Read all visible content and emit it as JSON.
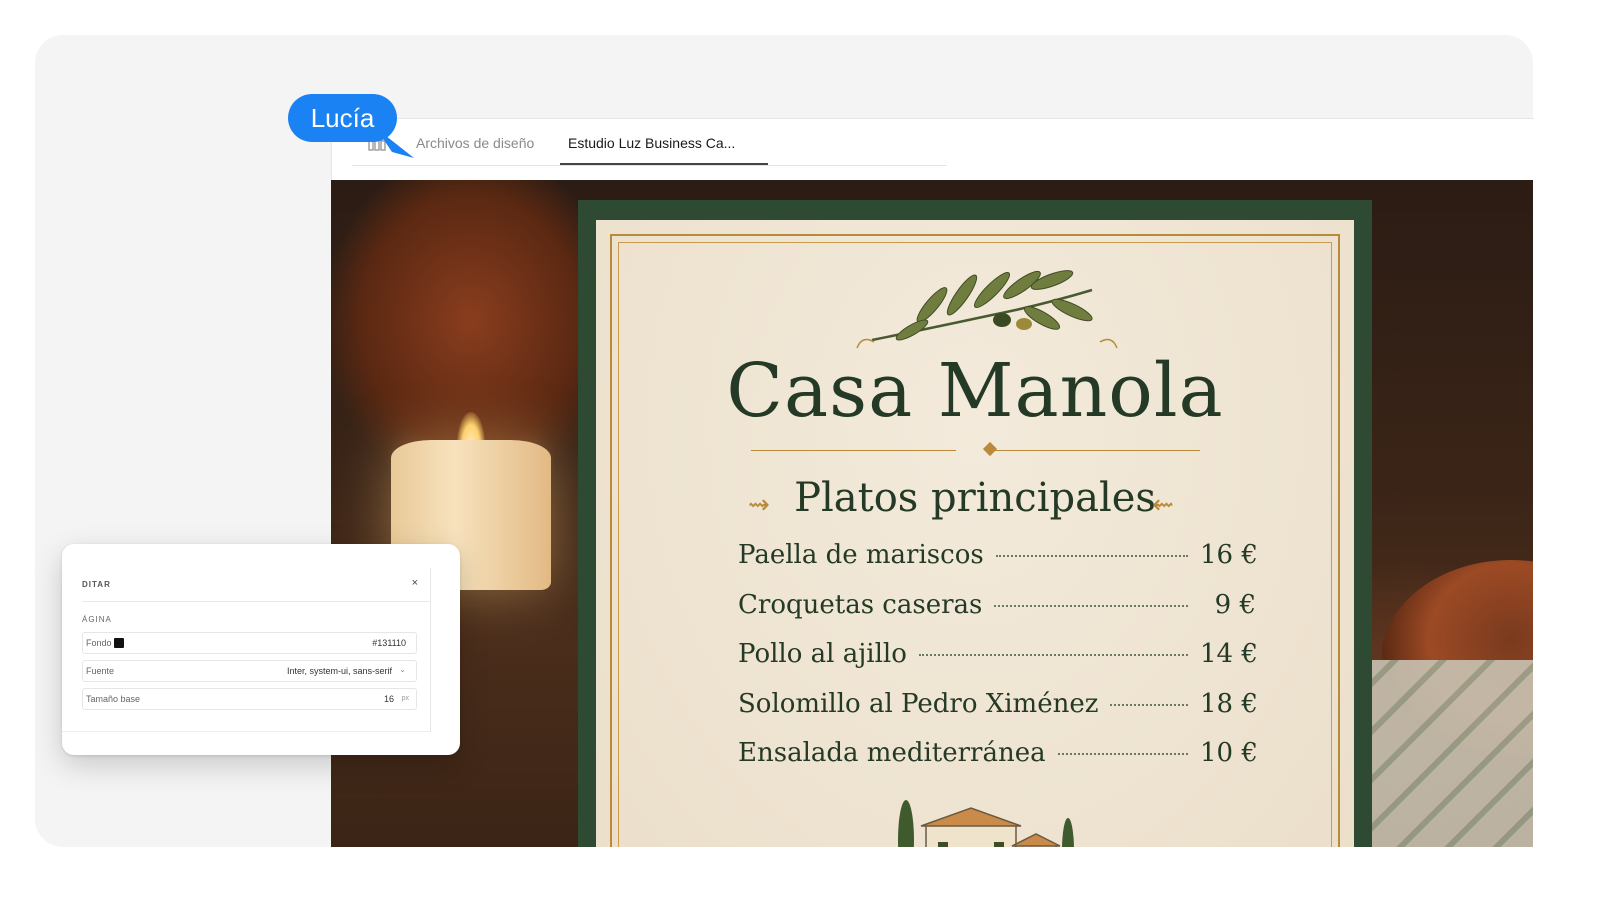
{
  "tabs": [
    {
      "label": "Archivos de diseño",
      "active": false
    },
    {
      "label": "Estudio Luz Business Ca...",
      "active": true
    }
  ],
  "cursor": {
    "user": "Lucía",
    "color": "#1a82f2"
  },
  "menu": {
    "restaurant_name": "Casa Manola",
    "section_title": "Platos principales",
    "dishes": [
      {
        "name": "Paella de mariscos",
        "price": "16 €"
      },
      {
        "name": "Croquetas caseras",
        "price": "9 €"
      },
      {
        "name": "Pollo al ajillo",
        "price": "14 €"
      },
      {
        "name": "Solomillo al Pedro Ximénez",
        "price": "18 €"
      },
      {
        "name": "Ensalada mediterránea",
        "price": "10 €"
      }
    ]
  },
  "edit_panel": {
    "heading": "DITAR",
    "close": "×",
    "section": "ÁGINA",
    "fields": {
      "background": {
        "label": "Fondo",
        "value": "#131110"
      },
      "font": {
        "label": "Fuente",
        "value": "Inter, system-ui, sans-serif"
      },
      "base_size": {
        "label": "Tamaño base",
        "value": "16",
        "unit": "px"
      }
    }
  },
  "colors": {
    "menu_green": "#2f4a33",
    "menu_gold": "#b98a3a",
    "paper": "#efe5d3"
  }
}
